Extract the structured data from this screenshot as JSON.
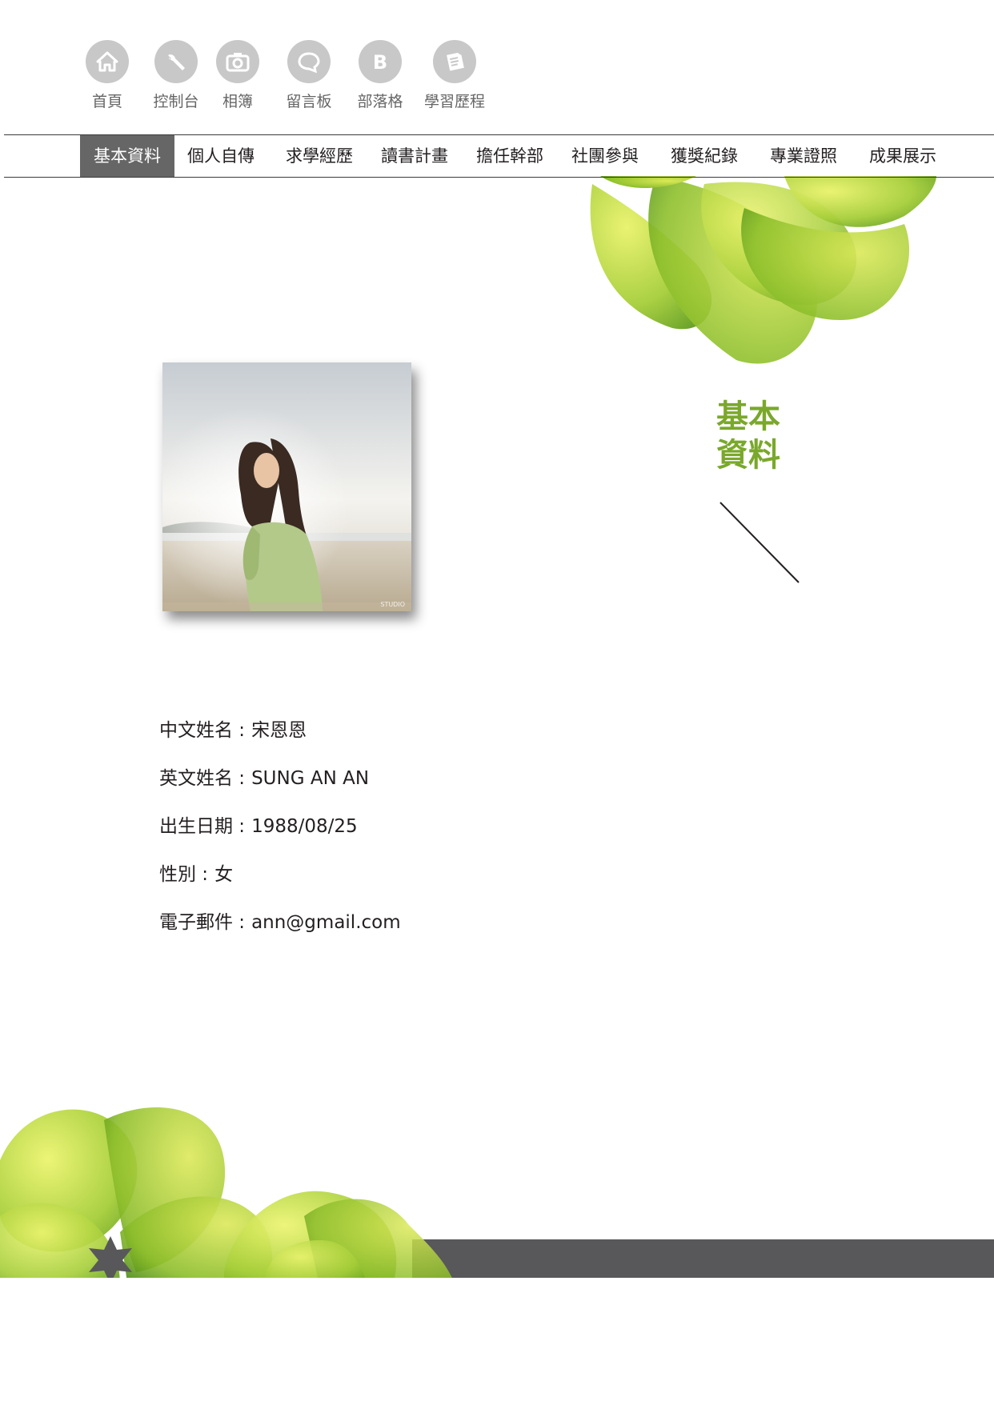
{
  "icon_nav": [
    {
      "label": "首頁",
      "icon": "home-icon"
    },
    {
      "label": "控制台",
      "icon": "wrench-icon"
    },
    {
      "label": "相簿",
      "icon": "camera-icon"
    },
    {
      "label": "留言板",
      "icon": "speech-bubble-icon"
    },
    {
      "label": "部落格",
      "icon": "blog-b-icon"
    },
    {
      "label": "學習歷程",
      "icon": "document-icon"
    }
  ],
  "tabs": [
    {
      "label": "基本資料",
      "active": true
    },
    {
      "label": "個人自傳"
    },
    {
      "label": "求學經歷"
    },
    {
      "label": "讀書計畫"
    },
    {
      "label": "擔任幹部"
    },
    {
      "label": "社團參與"
    },
    {
      "label": "獲獎紀錄"
    },
    {
      "label": "專業證照"
    },
    {
      "label": "成果展示"
    }
  ],
  "section": {
    "title_line1": "基本",
    "title_line2": "資料"
  },
  "profile": [
    {
      "label": "中文姓名 :",
      "value": " 宋恩恩"
    },
    {
      "label": "英文姓名 :",
      "value": "SUNG AN AN"
    },
    {
      "label": "出生日期 :",
      "value": "1988/08/25"
    },
    {
      "label": "性別 :",
      "value": "女"
    },
    {
      "label": "電子郵件 :",
      "value": "ann@gmail.com"
    }
  ],
  "colors": {
    "accent_green": "#7aa82b",
    "leaf_green": "#a6ce39",
    "active_tab": "#666666",
    "footer_bar": "#58585a",
    "icon_circle": "#c8c8c8"
  }
}
